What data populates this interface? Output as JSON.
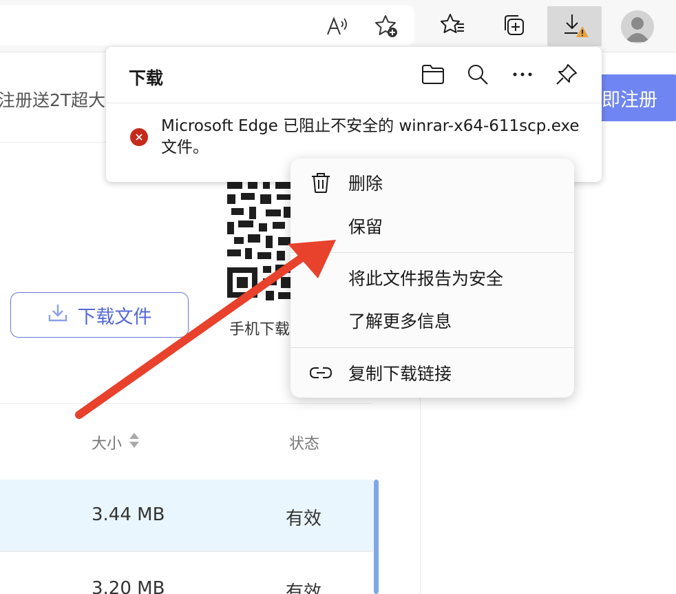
{
  "browser": {
    "accent": "#e8a33d",
    "icons": [
      "read-aloud-icon",
      "add-favorite-icon",
      "favorites-icon",
      "collections-icon",
      "download-warning-icon",
      "profile-icon"
    ]
  },
  "page": {
    "promo_text": "注册送2T超大",
    "register_label": "即注册",
    "register_color": "#6f86f2",
    "download_file_label": "下载文件",
    "qr_caption": "手机下载",
    "table": {
      "headers": {
        "size": "大小",
        "status": "状态"
      },
      "rows": [
        {
          "size": "3.44 MB",
          "status": "有效"
        },
        {
          "size": "3.20 MB",
          "status": "有效"
        }
      ]
    }
  },
  "downloads": {
    "title": "下载",
    "message": "Microsoft Edge 已阻止不安全的 winrar-x64-611scp.exe 文件。",
    "error_color": "#c42b1c"
  },
  "context_menu": {
    "items": [
      {
        "label": "删除",
        "icon": "trash-icon"
      },
      {
        "label": "保留",
        "icon": ""
      },
      {
        "label": "将此文件报告为安全",
        "icon": ""
      },
      {
        "label": "了解更多信息",
        "icon": ""
      },
      {
        "label": "复制下载链接",
        "icon": "link-icon"
      }
    ]
  },
  "annotation": {
    "arrow_color": "#e8412c"
  }
}
